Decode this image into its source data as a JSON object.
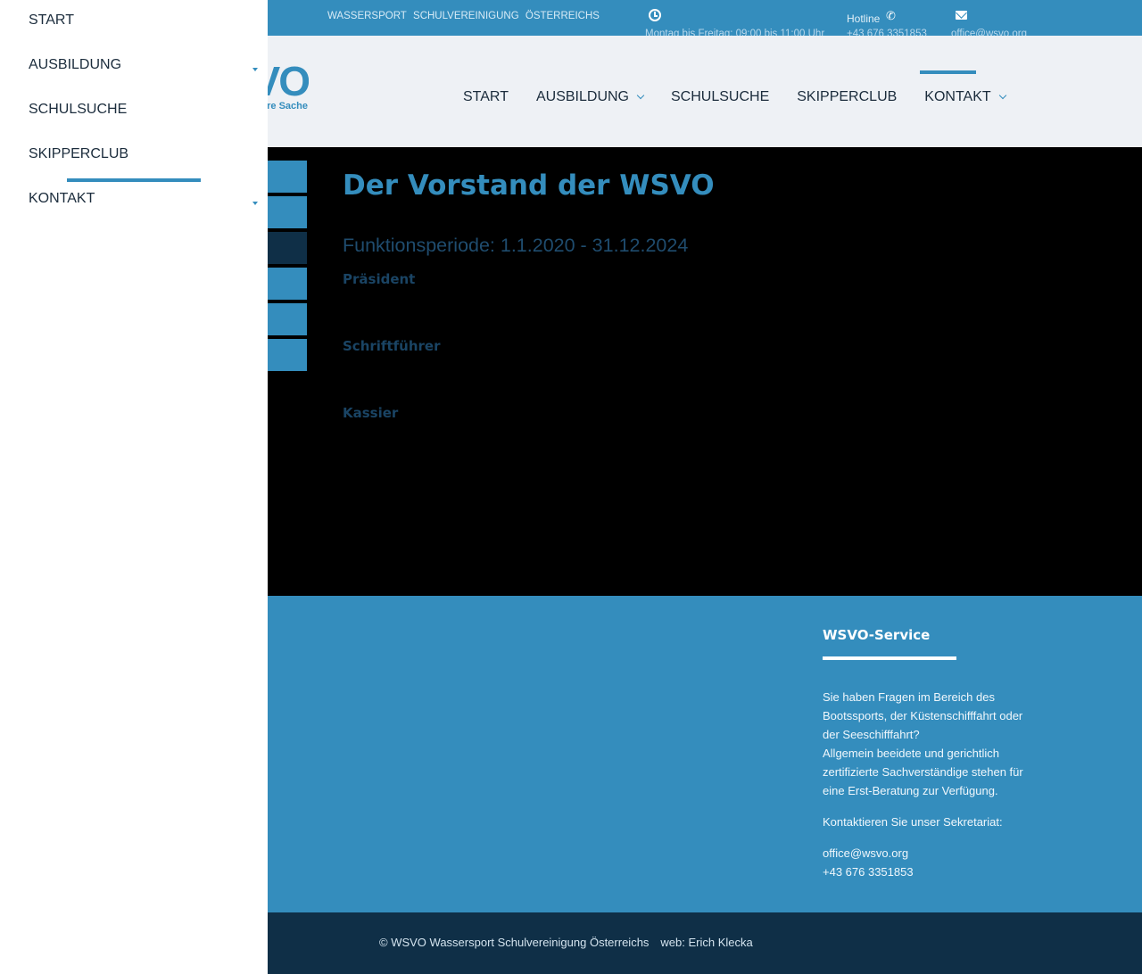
{
  "topbar": {
    "brand_words": [
      "WASSERSPORT",
      "SCHULVEREINIGUNG",
      "ÖSTERREICHS"
    ],
    "hours_icon": "clock-icon",
    "hours_text": "Montag bis Freitag: 09:00 bis 11:00 Uhr",
    "hotline_label": "Hotline",
    "phone_icon": "phone-icon",
    "hotline_number": "+43 676 3351853",
    "mail_icon": "mail-icon",
    "email": "office@wsvo.org"
  },
  "header": {
    "logo_text": "VO",
    "logo_tagline": "re Sache",
    "nav": [
      {
        "label": "START"
      },
      {
        "label": "AUSBILDUNG",
        "icon": "chevron-down-icon"
      },
      {
        "label": "SCHULSUCHE"
      },
      {
        "label": "SKIPPERCLUB"
      },
      {
        "label": "KONTAKT",
        "icon": "chevron-down-icon"
      }
    ]
  },
  "main": {
    "title": "Der Vorstand der WSVO",
    "period": "Funktionsperiode: 1.1.2020 - 31.12.2024",
    "roles": [
      "Präsident",
      "Schriftführer",
      "Kassier"
    ]
  },
  "footer": {
    "heading": "WSVO-Service",
    "paragraph1": "Sie haben Fragen im Bereich des Bootssports, der Küstenschifffahrt oder der Seeschifffahrt?",
    "paragraph2": "Allgemein beeidete und gerichtlich zertifizierte Sachverständige stehen für eine Erst-Beratung zur Verfügung.",
    "contact_label": "Kontaktieren Sie unser Sekretariat:",
    "email": "office@wsvo.org",
    "phone": "+43 676 3351853"
  },
  "bottom": {
    "copyright": "© WSVO Wassersport Schulvereinigung Österreichs",
    "credit": "web: Erich Klecka"
  },
  "drawer": {
    "items": [
      {
        "label": "START"
      },
      {
        "label": "AUSBILDUNG",
        "icon": "caret-down-icon"
      },
      {
        "label": "SCHULSUCHE"
      },
      {
        "label": "SKIPPERCLUB"
      },
      {
        "label": "KONTAKT",
        "icon": "caret-down-icon"
      }
    ]
  },
  "colors": {
    "accent": "#348dbd",
    "dark": "#0f2f47",
    "header_bg": "#eef1f5",
    "content_bg": "#000000"
  }
}
